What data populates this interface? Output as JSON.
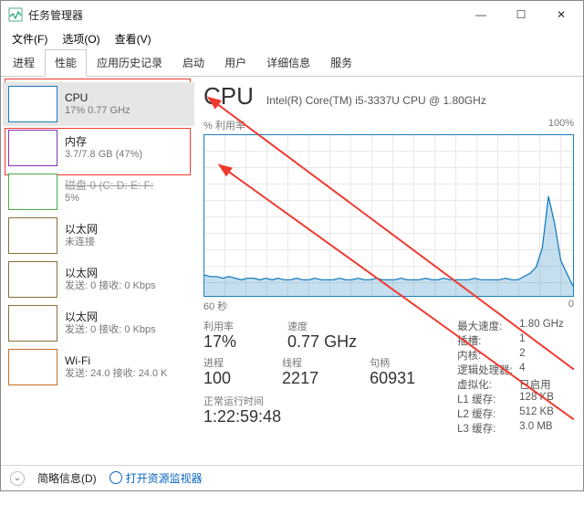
{
  "chart_data": {
    "type": "line",
    "title": "% 利用率",
    "xlabel": "60 秒",
    "ylabel": "",
    "ylim": [
      0,
      100
    ],
    "xlim_seconds": [
      60,
      0
    ],
    "series": [
      {
        "name": "CPU",
        "values_pct": [
          13,
          12,
          12,
          11,
          12,
          11,
          10,
          11,
          11,
          10,
          11,
          10,
          11,
          10,
          10,
          11,
          10,
          10,
          11,
          10,
          10,
          10,
          11,
          10,
          10,
          11,
          10,
          10,
          11,
          10,
          10,
          10,
          11,
          10,
          10,
          10,
          11,
          10,
          10,
          11,
          10,
          10,
          10,
          10,
          11,
          10,
          10,
          10,
          10,
          11,
          10,
          10,
          12,
          14,
          18,
          30,
          62,
          45,
          22,
          14,
          6
        ]
      }
    ],
    "colors": {
      "line": "#1a7fbf",
      "fill": "rgba(26,127,191,0.25)"
    }
  },
  "window": {
    "title": "任务管理器",
    "menu": {
      "file": "文件(F)",
      "options": "选项(O)",
      "view": "查看(V)"
    },
    "controls": {
      "min": "—",
      "max": "☐",
      "close": "✕"
    }
  },
  "tabs": [
    {
      "label": "进程"
    },
    {
      "label": "性能",
      "active": true
    },
    {
      "label": "应用历史记录"
    },
    {
      "label": "启动"
    },
    {
      "label": "用户"
    },
    {
      "label": "详细信息"
    },
    {
      "label": "服务"
    }
  ],
  "sidebar": {
    "items": [
      {
        "title": "CPU",
        "subtitle": "17% 0.77 GHz",
        "thumb": "cpu",
        "selected": true
      },
      {
        "title": "内存",
        "subtitle": "3.7/7.8 GB (47%)",
        "thumb": "mem"
      },
      {
        "title": "磁盘 0 (C: D: E: F:",
        "subtitle": "5%",
        "thumb": "disk",
        "strike": true
      },
      {
        "title": "以太网",
        "subtitle": "未连接",
        "thumb": "eth"
      },
      {
        "title": "以太网",
        "subtitle": "发送: 0 接收: 0 Kbps",
        "thumb": "eth"
      },
      {
        "title": "以太网",
        "subtitle": "发送: 0 接收: 0 Kbps",
        "thumb": "eth"
      },
      {
        "title": "Wi-Fi",
        "subtitle": "发送: 24.0 接收: 24.0 K",
        "thumb": "wifi"
      }
    ]
  },
  "main": {
    "title": "CPU",
    "subtitle": "Intel(R) Core(TM) i5-3337U CPU @ 1.80GHz",
    "plot_top_left": "% 利用率",
    "plot_top_right": "100%",
    "plot_bottom_left": "60 秒",
    "plot_bottom_right": "0",
    "stats": {
      "util_label": "利用率",
      "util_value": "17%",
      "speed_label": "速度",
      "speed_value": "0.77 GHz",
      "proc_label": "进程",
      "proc_value": "100",
      "thread_label": "线程",
      "thread_value": "2217",
      "handle_label": "句柄",
      "handle_value": "60931",
      "uptime_label": "正常运行时间",
      "uptime_value": "1:22:59:48"
    },
    "spec": {
      "maxspeed_k": "最大速度:",
      "maxspeed_v": "1.80 GHz",
      "sockets_k": "插槽:",
      "sockets_v": "1",
      "cores_k": "内核:",
      "cores_v": "2",
      "logical_k": "逻辑处理器:",
      "logical_v": "4",
      "virt_k": "虚拟化:",
      "virt_v": "已启用",
      "l1_k": "L1 缓存:",
      "l1_v": "128 KB",
      "l2_k": "L2 缓存:",
      "l2_v": "512 KB",
      "l3_k": "L3 缓存:",
      "l3_v": "3.0 MB"
    }
  },
  "bottom": {
    "simple": "简略信息(D)",
    "resmon": "打开资源监视器"
  }
}
